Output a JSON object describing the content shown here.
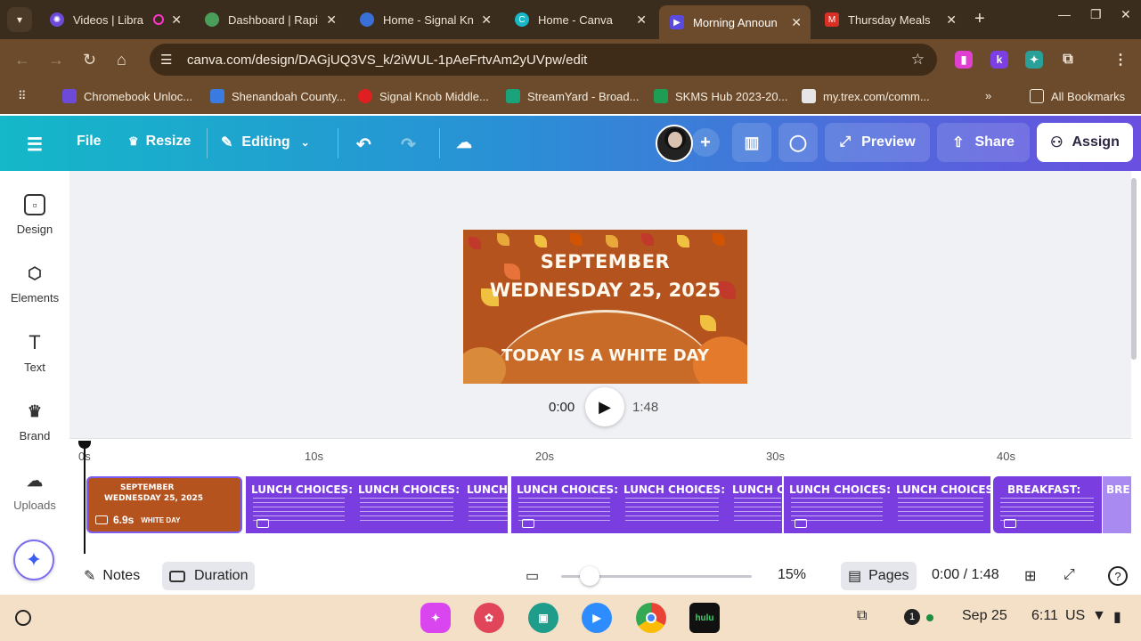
{
  "browser": {
    "tabs": [
      {
        "title": "Videos | Libra",
        "color": "#6d4bd8"
      },
      {
        "title": "Dashboard | Rapi",
        "color": "#4a9e5a"
      },
      {
        "title": "Home - Signal Kn",
        "color": "#3a6fd8"
      },
      {
        "title": "Home - Canva",
        "color": "#17b8c8"
      },
      {
        "title": "Morning Announ",
        "color": "#5a4ae0"
      },
      {
        "title": "Thursday Meals",
        "color": "#d93025"
      }
    ],
    "url": "canva.com/design/DAGjUQ3VS_k/2iWUL-1pAeFrtvAm2yUVpw/edit",
    "bookmarks": [
      {
        "label": "Chromebook Unloc...",
        "color": "#6d4bd8"
      },
      {
        "label": "Shenandoah County...",
        "color": "#3a7be0"
      },
      {
        "label": "Signal Knob Middle...",
        "color": "#e02020"
      },
      {
        "label": "StreamYard - Broad...",
        "color": "#1aa37a"
      },
      {
        "label": "SKMS Hub 2023-20...",
        "color": "#1f9d55"
      },
      {
        "label": "my.trex.com/comm...",
        "color": "#e6e6e6"
      }
    ],
    "all_bookmarks": "All Bookmarks",
    "overflow": "»"
  },
  "canva": {
    "topbar": {
      "file": "File",
      "resize": "Resize",
      "editing": "Editing",
      "preview": "Preview",
      "share": "Share",
      "assign": "Assign"
    },
    "sidebar": [
      {
        "label": "Design",
        "icon": "layout-icon"
      },
      {
        "label": "Elements",
        "icon": "shapes-icon"
      },
      {
        "label": "Text",
        "icon": "text-icon"
      },
      {
        "label": "Brand",
        "icon": "crown-icon"
      },
      {
        "label": "Uploads",
        "icon": "cloud-upload-icon"
      }
    ],
    "slide": {
      "line1": "SEPTEMBER",
      "line2": "WEDNESDAY 25, 2025",
      "line3": "TODAY IS A WHITE DAY"
    },
    "player": {
      "current": "0:00",
      "total": "1:48"
    },
    "timeline": {
      "ticks": [
        "0s",
        "10s",
        "20s",
        "30s",
        "40s"
      ],
      "clip1": {
        "title_line1": "SEPTEMBER",
        "title_line2": "WEDNESDAY 25, 2025",
        "duration": "6.9s",
        "caption": "WHITE DAY"
      },
      "clips": [
        "LUNCH CHOICES:",
        "LUNCH CHOICES:",
        "LUNCH CH",
        "LUNCH CHOICES:",
        "LUNCH CHOICES:",
        "LUNCH CHO",
        "LUNCH CHOICES:",
        "LUNCH CHOICES:",
        "BREAKFAST:",
        "BRE"
      ]
    },
    "bottombar": {
      "notes": "Notes",
      "duration": "Duration",
      "zoom": "15%",
      "pages": "Pages",
      "time": "0:00 / 1:48"
    }
  },
  "shelf": {
    "notification_count": "1",
    "date": "Sep 25",
    "time": "6:11",
    "locale": "US"
  }
}
